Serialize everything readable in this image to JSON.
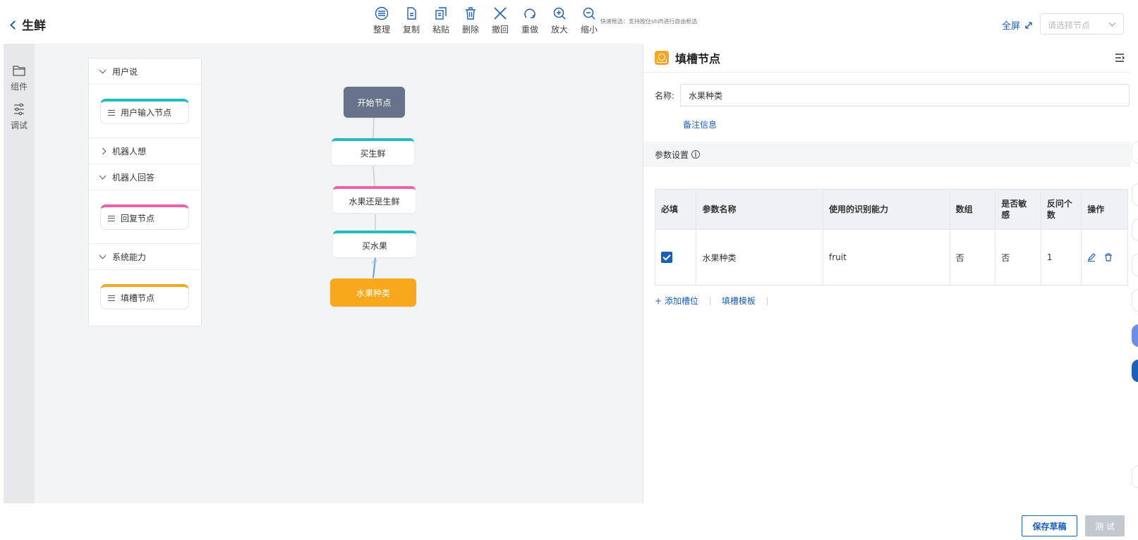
{
  "header": {
    "title": "生鲜",
    "hint": "快速框选：支持按住shift进行自由框选",
    "fullscreen_label": "全屏",
    "node_select_placeholder": "请选择节点"
  },
  "toolbar": [
    {
      "icon": "arrange-icon",
      "label": "整理"
    },
    {
      "icon": "copy-icon",
      "label": "复制"
    },
    {
      "icon": "paste-icon",
      "label": "粘贴"
    },
    {
      "icon": "delete-icon",
      "label": "删除"
    },
    {
      "icon": "undo-icon",
      "label": "撤回"
    },
    {
      "icon": "redo-icon",
      "label": "重做"
    },
    {
      "icon": "zoom-in-icon",
      "label": "放大"
    },
    {
      "icon": "zoom-out-icon",
      "label": "缩小"
    }
  ],
  "rail": [
    {
      "icon": "folder-icon",
      "label": "组件"
    },
    {
      "icon": "sliders-icon",
      "label": "调试"
    }
  ],
  "palette": {
    "categories": [
      {
        "label": "用户说",
        "expanded": true,
        "node": {
          "label": "用户输入节点",
          "color": "#21bcc2"
        }
      },
      {
        "label": "机器人想",
        "expanded": false
      },
      {
        "label": "机器人回答",
        "expanded": true,
        "node": {
          "label": "回复节点",
          "color": "#ee5fa7"
        }
      },
      {
        "label": "系统能力",
        "expanded": true,
        "node": {
          "label": "填槽节点",
          "color": "#f5a623"
        }
      }
    ]
  },
  "flow": {
    "nodes": [
      {
        "label": "开始节点",
        "type": "start"
      },
      {
        "label": "买生鲜",
        "type": "input"
      },
      {
        "label": "水果还是生鲜",
        "type": "reply"
      },
      {
        "label": "买水果",
        "type": "input"
      },
      {
        "label": "水果种类",
        "type": "slot"
      }
    ]
  },
  "panel": {
    "title": "填槽节点",
    "name_label": "名称:",
    "name_value": "水果种类",
    "remark_link": "备注信息",
    "section_title": "参数设置",
    "table": {
      "headers": [
        "必填",
        "参数名称",
        "使用的识别能力",
        "数组",
        "是否敏感",
        "反问个数",
        "操作"
      ],
      "rows": [
        {
          "required": true,
          "name": "水果种类",
          "ability": "fruit",
          "array": "否",
          "sensitive": "否",
          "ask_count": "1"
        }
      ]
    },
    "add_slot_link": "+ 添加槽位",
    "template_link": "填槽模板"
  },
  "footer": {
    "save_label": "保存草稿",
    "test_label": "测 试"
  },
  "colors": {
    "accent": "#1c5fb8",
    "start_node": "#66738a",
    "slot_node": "#f7a81b",
    "input_node": "#21bcc2",
    "reply_node": "#ee5fa7"
  }
}
